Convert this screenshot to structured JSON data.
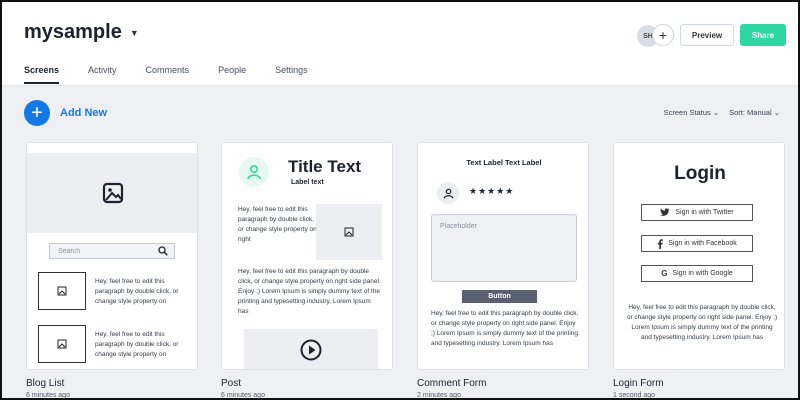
{
  "header": {
    "project_name": "mysample",
    "avatar_initials": "SH",
    "preview_label": "Preview",
    "share_label": "Share"
  },
  "tabs": [
    {
      "label": "Screens",
      "active": true
    },
    {
      "label": "Activity"
    },
    {
      "label": "Comments"
    },
    {
      "label": "People"
    },
    {
      "label": "Settings"
    }
  ],
  "toolbar": {
    "add_new_label": "Add New",
    "screen_status_label": "Screen Status ⌄",
    "sort_label": "Sort: Manual ⌄"
  },
  "cards": [
    {
      "name": "Blog List",
      "time": "6 minutes ago",
      "search_placeholder": "Search",
      "row1_text": "Hey, feel free to edit this paragraph by double click, or change style property on",
      "row2_text": "Hey, feel free to edit this paragraph by double click, or change style property on"
    },
    {
      "name": "Post",
      "time": "6 minutes ago",
      "title": "Title Text",
      "subtitle": "Label text",
      "side_text": "Hey, feel free to edit this paragraph by double click, or change style property on right",
      "body_text": "Hey, feel free to edit this paragraph by double click, or change style property on right side panel. Enjoy ;) Lorem Ipsum is simply dummy text of the printing and typesetting industry. Lorem Ipsum has"
    },
    {
      "name": "Comment Form",
      "time": "2 minutes ago",
      "label": "Text Label Text Label",
      "stars": "★★★★★",
      "placeholder": "Placeholder",
      "button_label": "Button",
      "body_text": "Hey, feel free to edit this paragraph by double click, or change style property on right side panel. Enjoy ;) Lorem Ipsum is simply dummy text of the printing and typesetting industry. Lorem Ipsum has"
    },
    {
      "name": "Login Form",
      "time": "1 second ago",
      "title": "Login",
      "twitter_label": "Sign in with Twitter",
      "facebook_label": "Sign in with Facebook",
      "google_label": "Sign in with Google",
      "body_text": "Hey, feel free to edit this paragraph by double click, or change style property on right side panel. Enjoy ;) Lorem Ipsum is simply dummy text of the printing and typesetting industry. Lorem Ipsum has"
    }
  ],
  "colors": {
    "accent_blue": "#1478e6",
    "share_green": "#2ed6a3",
    "button_gray": "#5a6070"
  }
}
